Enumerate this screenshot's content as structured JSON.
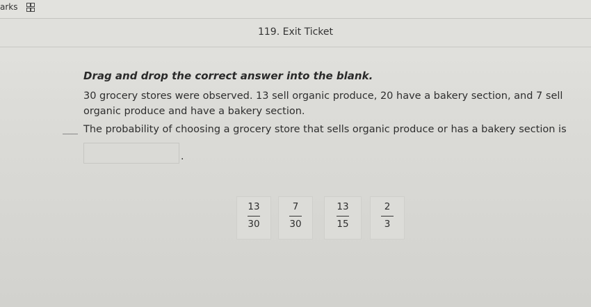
{
  "topbar": {
    "label": "arks",
    "grid_icon": "grid-icon"
  },
  "header": {
    "title": "119. Exit Ticket"
  },
  "question": {
    "instruction": "Drag and drop the correct answer into the blank.",
    "body": "30 grocery stores were observed. 13 sell organic produce, 20 have a bakery section, and 7 sell organic produce and have a bakery section.",
    "prompt": "The probability of choosing a grocery store that sells organic produce or has a bakery section is",
    "blank_suffix": "."
  },
  "answers": [
    {
      "numerator": "13",
      "denominator": "30"
    },
    {
      "numerator": "7",
      "denominator": "30"
    },
    {
      "numerator": "13",
      "denominator": "15"
    },
    {
      "numerator": "2",
      "denominator": "3"
    }
  ]
}
